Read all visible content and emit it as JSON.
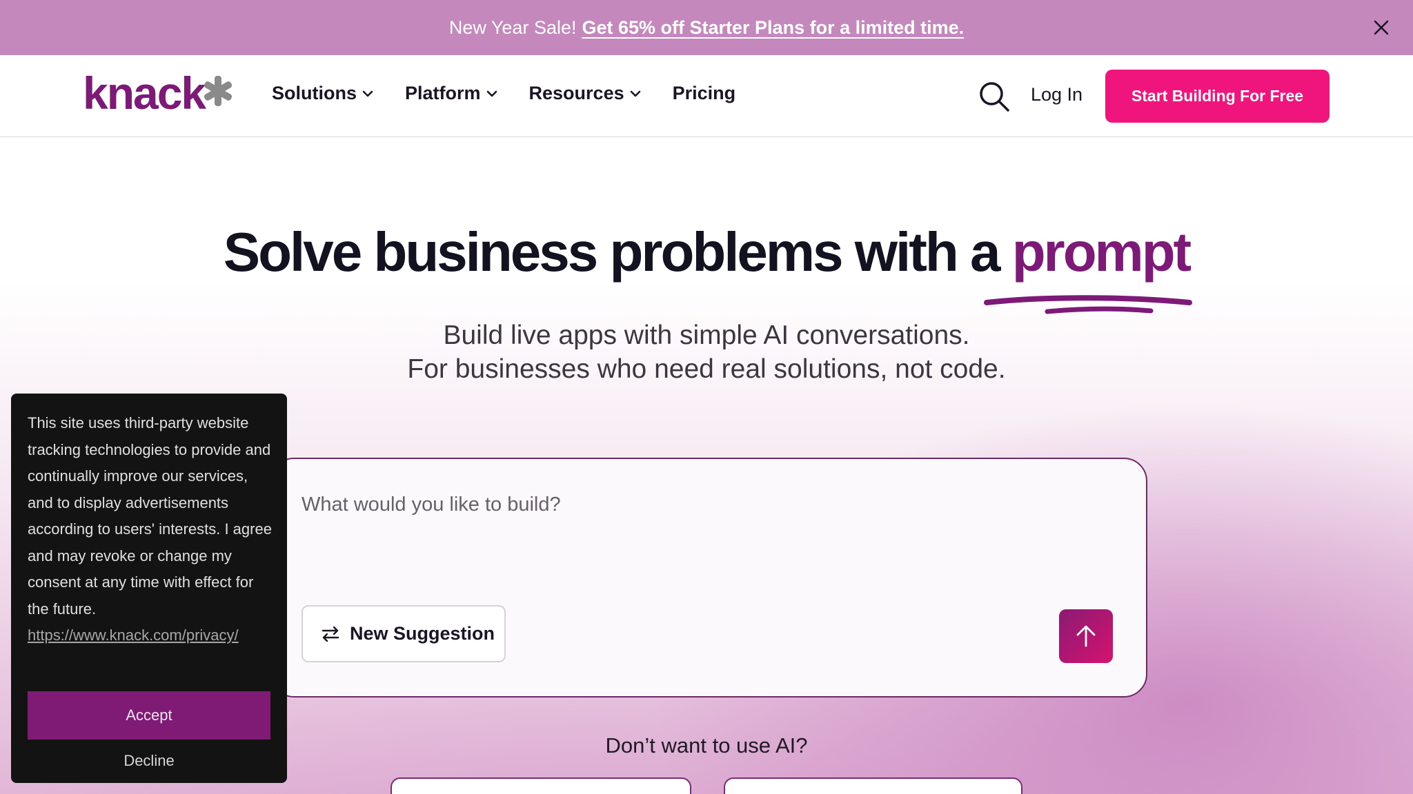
{
  "promo": {
    "text": "New Year Sale!",
    "link": "Get 65% off Starter Plans for a limited time.",
    "close_icon": "close-icon"
  },
  "header": {
    "logo_text": "knack",
    "nav": [
      {
        "label": "Solutions",
        "has_dropdown": true
      },
      {
        "label": "Platform",
        "has_dropdown": true
      },
      {
        "label": "Resources",
        "has_dropdown": true
      },
      {
        "label": "Pricing",
        "has_dropdown": false
      }
    ],
    "search_icon": "search-icon",
    "login": "Log In",
    "cta": "Start Building For Free"
  },
  "hero": {
    "title_main": "Solve business problems with a",
    "title_accent": "prompt",
    "subtitle_line1": "Build live apps with simple AI conversations.",
    "subtitle_line2": "For businesses who need real solutions, not code."
  },
  "prompt": {
    "placeholder": "What would you like to build?",
    "suggestion_button": "New Suggestion",
    "suggestion_icon": "swap-arrows-icon",
    "submit_icon": "arrow-up-icon"
  },
  "alternatives": {
    "heading": "Don’t want to use AI?"
  },
  "cookie": {
    "text": "This site uses third-party website tracking technologies to provide and continually improve our services, and to display advertisements according to users' interests. I agree and may revoke or change my consent at any time with effect for the future.",
    "link": "https://www.knack.com/privacy/",
    "accept": "Accept",
    "decline": "Decline"
  },
  "colors": {
    "promo_bg": "#c488bd",
    "brand_purple": "#7d1a78",
    "cta_pink": "#f0157d",
    "cookie_bg": "#141314",
    "accept_bg": "#7f1a75"
  }
}
